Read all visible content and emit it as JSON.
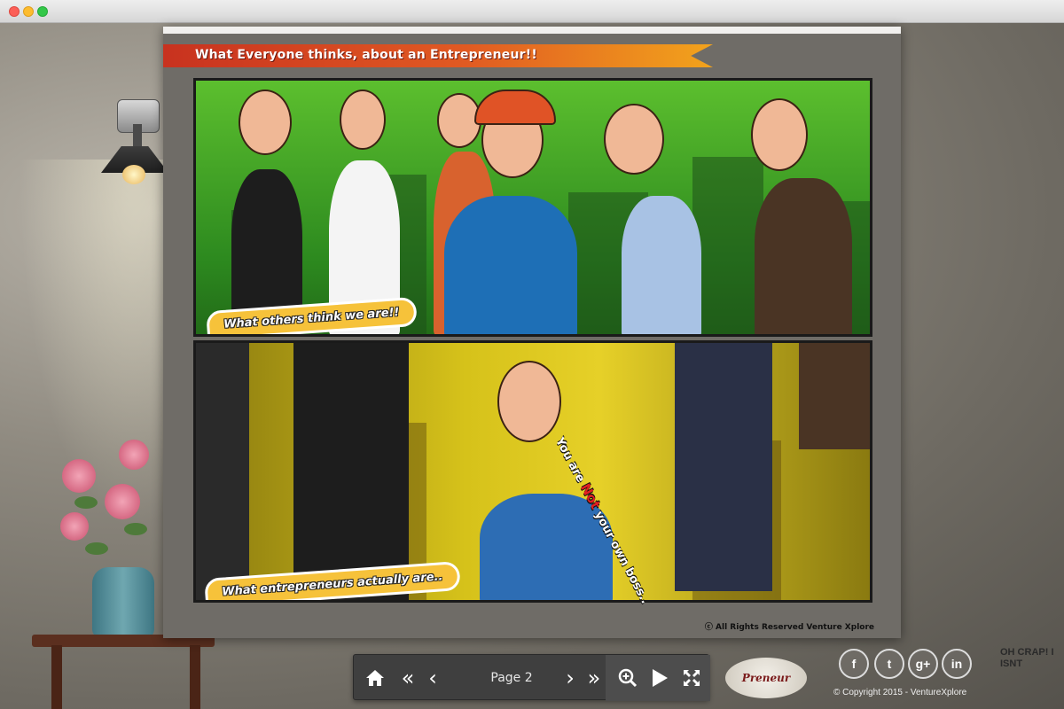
{
  "window": {
    "controls": [
      "close",
      "minimize",
      "maximize"
    ]
  },
  "book": {
    "banner_title": "What Everyone thinks, about an Entrepreneur!!",
    "panel_top_caption": "What others think we are!!",
    "panel_bottom_caption": "What entrepreneurs actually are..",
    "speech": {
      "part1": "You are",
      "not": "Not",
      "part2": "your own boss.."
    },
    "rights": "All Rights Reserved Venture Xplore"
  },
  "toolbar": {
    "page_label": "Page 2",
    "icons": [
      "home-icon",
      "first-page-icon",
      "prev-page-icon",
      "next-page-icon",
      "last-page-icon",
      "zoom-in-icon",
      "play-icon",
      "fullscreen-icon"
    ]
  },
  "social": {
    "facebook": "f",
    "twitter": "t",
    "googleplus": "g+",
    "linkedin": "in"
  },
  "footer": {
    "copyright": "© Copyright 2015 - VentureXplore"
  },
  "decor": {
    "logo_text": "Preneur",
    "wall_text": "OH CRAP! I ISNT"
  },
  "colors": {
    "banner_start": "#c8321f",
    "banner_end": "#f2a31c",
    "caption_bg": "#f6c23a",
    "toolbar_bg": "#3f3f3f"
  }
}
